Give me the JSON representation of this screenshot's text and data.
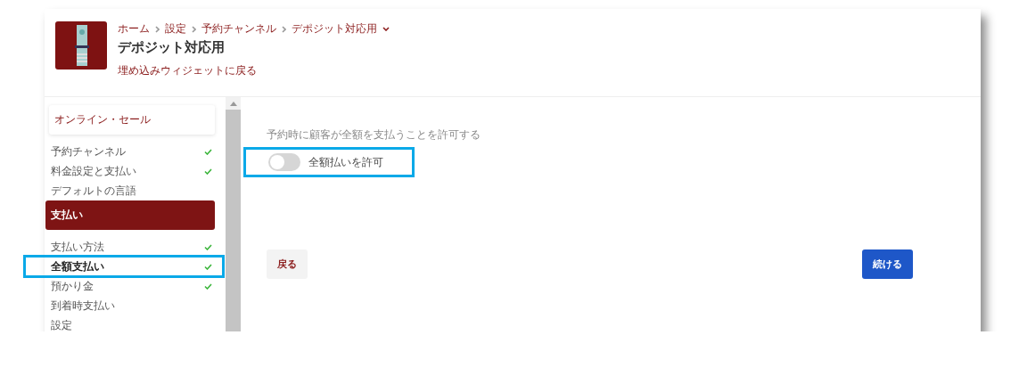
{
  "header": {
    "breadcrumb": [
      {
        "label": "ホーム"
      },
      {
        "label": "設定"
      },
      {
        "label": "予約チャンネル"
      },
      {
        "label": "デポジット対応用",
        "dropdown": true
      }
    ],
    "title": "デポジット対応用",
    "back_link": "埋め込みウィジェットに戻る"
  },
  "sidebar": {
    "groups": [
      {
        "title": "オンライン・セール",
        "selected": false,
        "items": [
          {
            "label": "予約チャンネル",
            "checked": true,
            "selected": false,
            "highlighted": false
          },
          {
            "label": "料金設定と支払い",
            "checked": true,
            "selected": false,
            "highlighted": false
          },
          {
            "label": "デフォルトの言語",
            "checked": false,
            "selected": false,
            "highlighted": false
          }
        ]
      },
      {
        "title": "支払い",
        "selected": true,
        "items": [
          {
            "label": "支払い方法",
            "checked": true,
            "selected": false,
            "highlighted": false
          },
          {
            "label": "全額支払い",
            "checked": true,
            "selected": true,
            "highlighted": true
          },
          {
            "label": "預かり金",
            "checked": true,
            "selected": false,
            "highlighted": false
          },
          {
            "label": "到着時支払い",
            "checked": false,
            "selected": false,
            "highlighted": false
          },
          {
            "label": "設定",
            "checked": false,
            "selected": false,
            "highlighted": false
          }
        ]
      }
    ]
  },
  "content": {
    "setting": {
      "description": "予約時に顧客が全額を支払うことを許可する",
      "label": "全額払いを許可",
      "on": false,
      "highlighted": true
    },
    "buttons": [
      {
        "label": "戻る",
        "kind": "secondary"
      },
      {
        "label": "続ける",
        "kind": "primary"
      }
    ]
  }
}
